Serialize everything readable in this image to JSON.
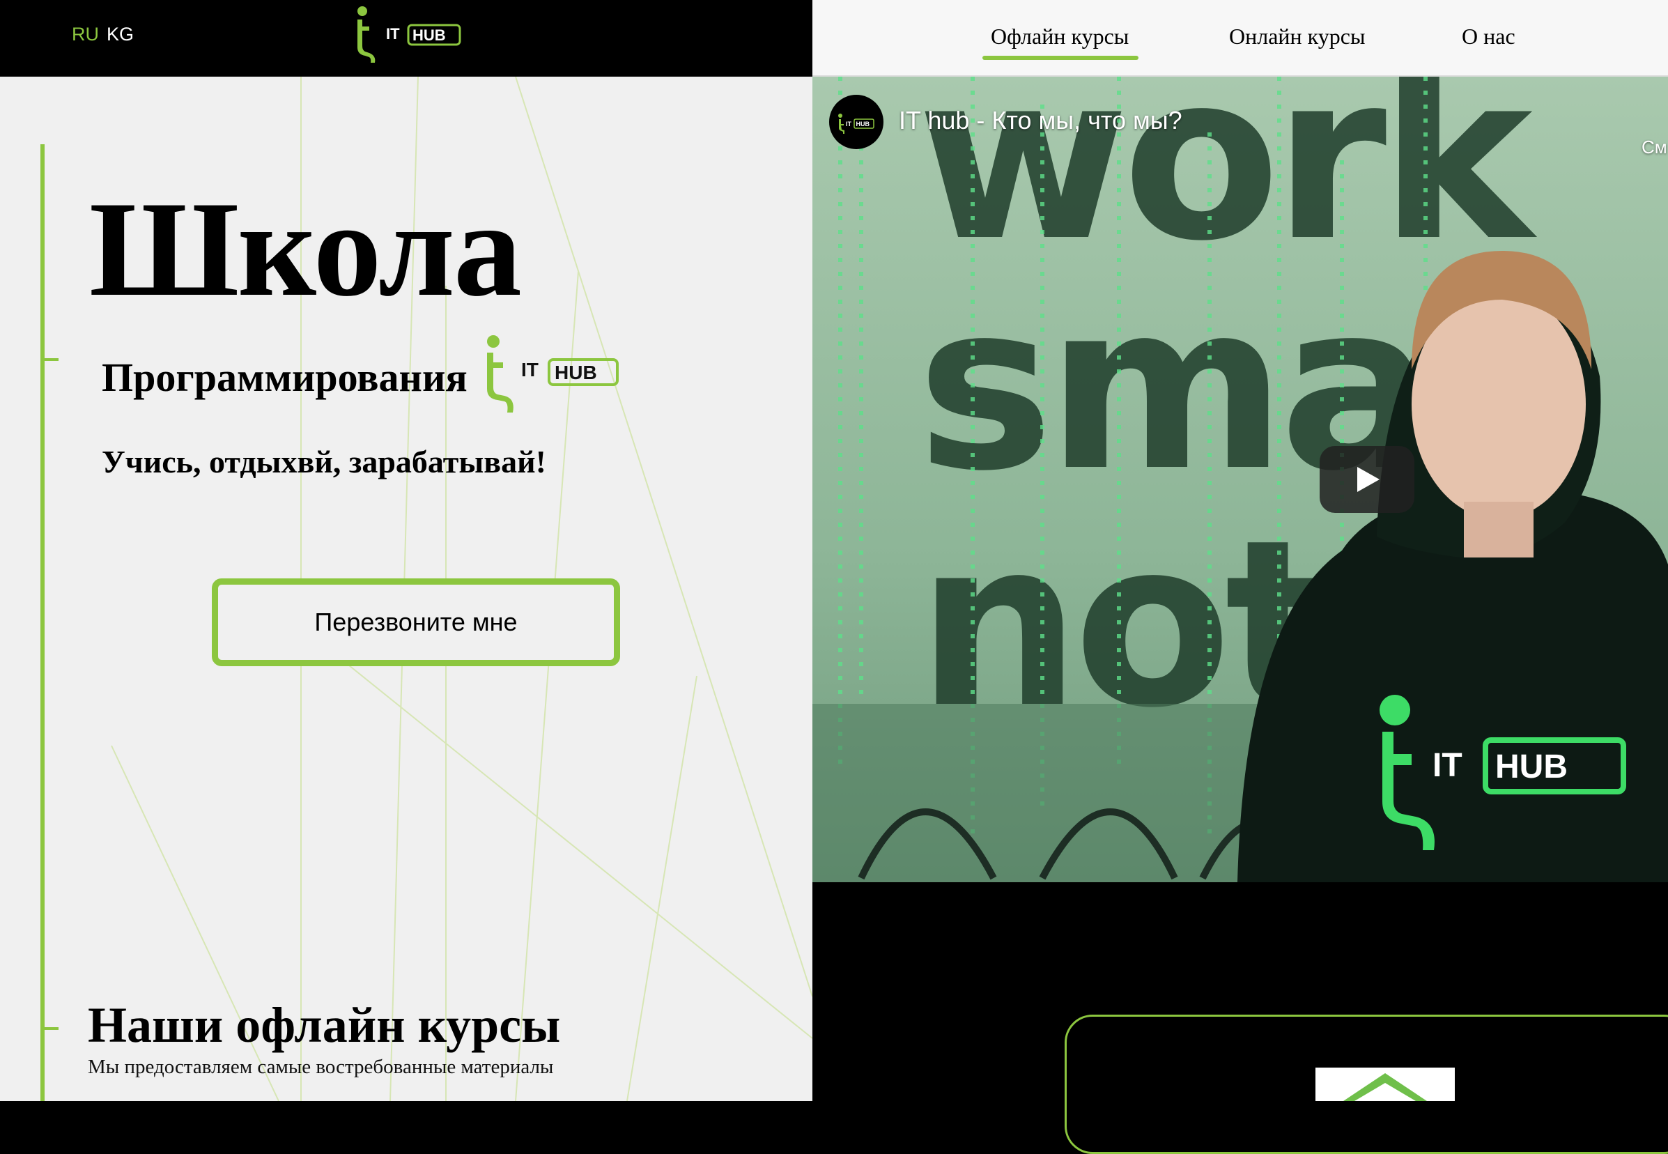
{
  "header": {
    "languages": [
      {
        "code": "RU",
        "active": true
      },
      {
        "code": "KG",
        "active": false
      }
    ],
    "logo": {
      "icon": "ithub-logo",
      "text_it": "IT",
      "text_hub": "HUB"
    }
  },
  "nav": {
    "items": [
      {
        "label": "Офлайн курсы",
        "active": true
      },
      {
        "label": "Онлайн курсы",
        "active": false
      },
      {
        "label": "О нас",
        "active": false
      }
    ]
  },
  "hero": {
    "title": "Школа",
    "subtitle": "Программирования",
    "tagline": "Учись, отдыхвй, зарабатывай!",
    "cta_label": "Перезвоните мне"
  },
  "video": {
    "title": "IT hub - Кто мы, что мы?",
    "more_label": "См",
    "play_icon": "play-icon",
    "hoodie_logo": {
      "text_it": "IT",
      "text_hub": "HUB"
    }
  },
  "section": {
    "title": "Наши офлайн курсы",
    "subtitle": "Мы предоставляем самые востребованные материалы"
  },
  "colors": {
    "accent": "#8cc63f",
    "dark": "#000000",
    "light_bg": "#f0f0f0"
  }
}
